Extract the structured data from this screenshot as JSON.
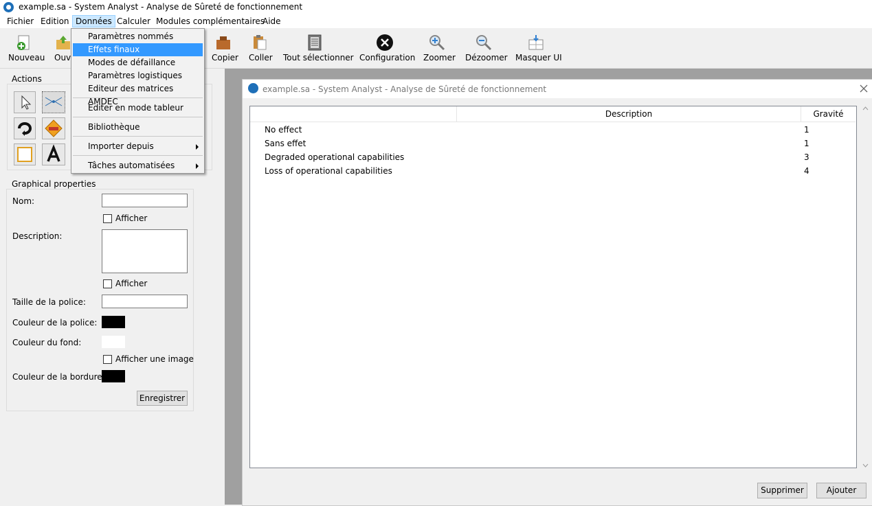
{
  "window": {
    "title": "example.sa - System Analyst - Analyse de Sûreté de fonctionnement"
  },
  "menubar": {
    "items": [
      "Fichier",
      "Edition",
      "Données",
      "Calculer",
      "Modules complémentaires",
      "Aide"
    ],
    "active": "Données"
  },
  "toolbar": {
    "nouveau": "Nouveau",
    "ouvrir": "Ouvr",
    "copier": "Copier",
    "coller": "Coller",
    "tout_selectionner": "Tout sélectionner",
    "configuration": "Configuration",
    "zoomer": "Zoomer",
    "dezoomer": "Dézoomer",
    "masquer_ui": "Masquer UI"
  },
  "dropdown": {
    "items": [
      "Paramètres nommés",
      "Effets finaux",
      "Modes de défaillance",
      "Paramètres logistiques",
      "Editeur des matrices AMDEC",
      "Editer en mode tableur",
      "Bibliothèque",
      "Importer depuis",
      "Tâches automatisées"
    ],
    "highlighted": "Effets finaux"
  },
  "actions": {
    "title": "Actions"
  },
  "properties": {
    "title": "Graphical properties",
    "nom_label": "Nom:",
    "nom_value": "",
    "afficher_label": "Afficher",
    "description_label": "Description:",
    "description_value": "",
    "taille_label": "Taille de la police:",
    "taille_value": "",
    "couleur_police_label": "Couleur de la police:",
    "couleur_fond_label": "Couleur du fond:",
    "afficher_image_label": "Afficher une image",
    "couleur_bordure_label": "Couleur de la bordure:",
    "couleur_police": "#000000",
    "couleur_fond": "#ffffff",
    "couleur_bordure": "#000000",
    "enregistrer": "Enregistrer"
  },
  "dialog": {
    "title": "example.sa - System Analyst - Analyse de Sûreté de fonctionnement",
    "columns": [
      "Description",
      "Gravité"
    ],
    "rows": [
      {
        "description": "No effect",
        "gravite": "1"
      },
      {
        "description": "Sans effet",
        "gravite": "1"
      },
      {
        "description": "Degraded operational capabilities",
        "gravite": "3"
      },
      {
        "description": "Loss of operational capabilities",
        "gravite": "4"
      }
    ],
    "supprimer": "Supprimer",
    "ajouter": "Ajouter"
  },
  "colors": {
    "highlight": "#3399ff",
    "menu_active": "#cce8ff"
  }
}
